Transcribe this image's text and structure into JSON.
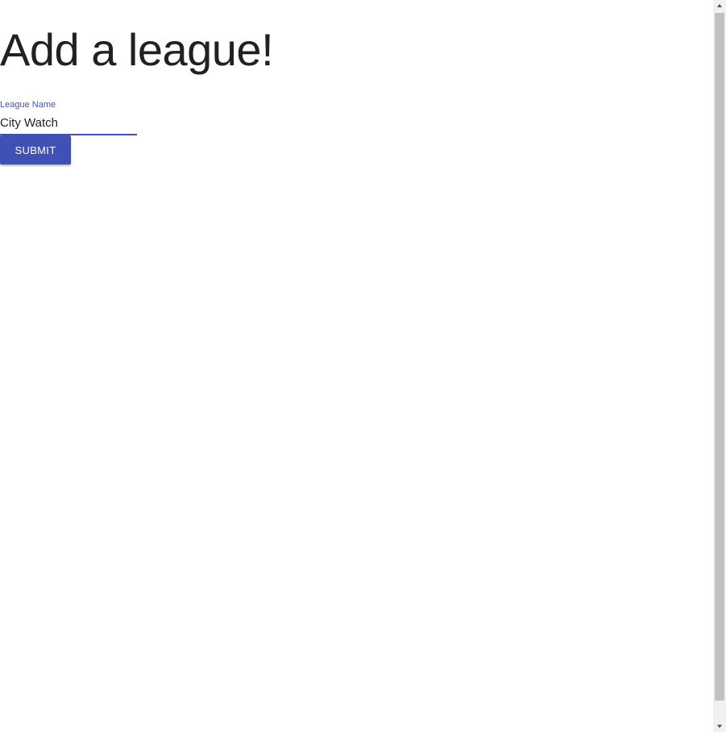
{
  "page": {
    "heading": "Add a league!"
  },
  "form": {
    "league_name_label": "League Name",
    "league_name_value": "City Watch",
    "submit_label": "SUBMIT"
  },
  "colors": {
    "primary": "#3f51b5",
    "text": "#212121",
    "button_text": "#ffffff"
  },
  "icons": {
    "scroll_up": "arrow-up-icon",
    "scroll_down": "arrow-down-icon"
  }
}
